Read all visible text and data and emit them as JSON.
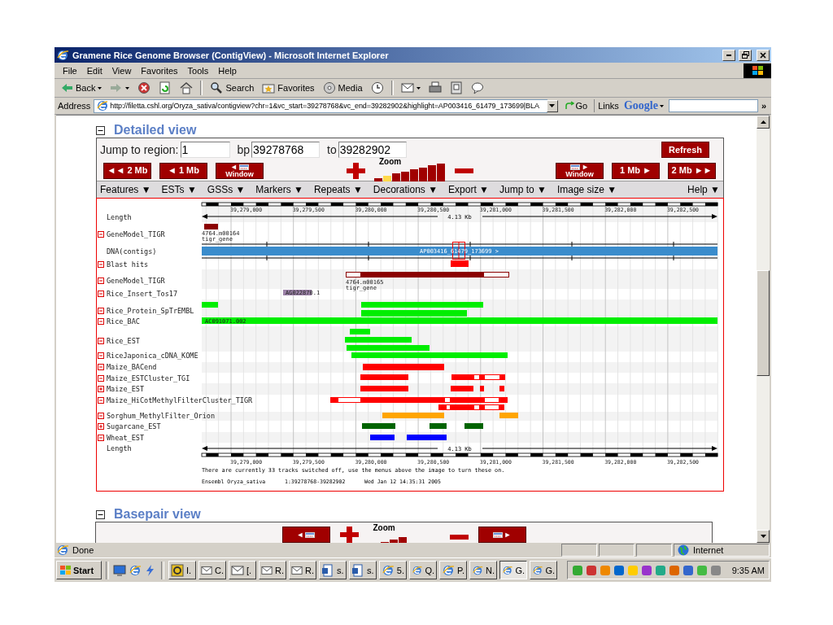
{
  "window": {
    "title": "Gramene Rice Genome Browser (ContigView) - Microsoft Internet Explorer"
  },
  "menu": [
    "File",
    "Edit",
    "View",
    "Favorites",
    "Tools",
    "Help"
  ],
  "toolbar": [
    {
      "kind": "back",
      "label": "Back"
    },
    {
      "kind": "forward"
    },
    {
      "kind": "stop"
    },
    {
      "kind": "refresh"
    },
    {
      "kind": "home"
    },
    {
      "kind": "search",
      "label": "Search"
    },
    {
      "kind": "favorites",
      "label": "Favorites"
    },
    {
      "kind": "media",
      "label": "Media"
    },
    {
      "kind": "history"
    },
    {
      "kind": "mail"
    },
    {
      "kind": "print"
    },
    {
      "kind": "edit"
    },
    {
      "kind": "discuss"
    }
  ],
  "address_bar": {
    "label": "Address",
    "url": "http://filetta.cshl.org/Oryza_sativa/contigview?chr=1&vc_start=39278768&vc_end=39282902&highlight=AP003416_61479_173699|BLA",
    "go": "Go",
    "links": "Links",
    "google": "Google",
    "more": "»"
  },
  "detailed_view": {
    "title": "Detailed view",
    "expanded": true,
    "jump_label": "Jump to region:",
    "region": "1",
    "bp_label": "bp",
    "start": "39278768",
    "to_label": "to",
    "end": "39282902",
    "refresh": "Refresh",
    "nav_left": [
      {
        "kind": "step",
        "label": "◄◄ 2 Mb"
      },
      {
        "kind": "step",
        "label": "◄ 1 Mb"
      },
      {
        "kind": "window",
        "arrow": "◄",
        "label": "Window"
      }
    ],
    "zoom": {
      "label": "Zoom",
      "steps": [
        {
          "selected": false
        },
        {
          "selected": true
        },
        {
          "selected": false
        },
        {
          "selected": false
        },
        {
          "selected": false
        },
        {
          "selected": false
        },
        {
          "selected": false
        },
        {
          "selected": false
        }
      ]
    },
    "nav_right": [
      {
        "kind": "window",
        "arrow": "►",
        "label": "Window"
      },
      {
        "kind": "step",
        "label": "1 Mb ►"
      },
      {
        "kind": "step",
        "label": "2 Mb ►►"
      }
    ],
    "menus": [
      "Features ▼",
      "ESTs ▼",
      "GSSs ▼",
      "Markers ▼",
      "Repeats ▼",
      "Decorations ▼",
      "Export ▼",
      "Jump to ▼",
      "Image size ▼"
    ],
    "help": "Help ▼"
  },
  "tracks_panel": {
    "top_ticks": [
      "39,279,000",
      "39,279,500",
      "39,280,000",
      "39,280,500",
      "39,281,000",
      "39,281,500",
      "39,282,000",
      "39,282,500"
    ],
    "tracks": [
      {
        "kind": "scale",
        "label": "Length",
        "span": "4.13 Kb"
      },
      {
        "kind": "track",
        "label": "GeneModel_TIGR",
        "expanded": true,
        "color": "#8b0000",
        "feature_labels": [
          "4764.m00164",
          "tigr_gene"
        ]
      },
      {
        "kind": "contig",
        "label": "DNA(contigs)",
        "color": "#3a8ccc",
        "feature_labels": [
          "AP003416_61479_173699 >"
        ]
      },
      {
        "kind": "track",
        "label": "Blast hits",
        "expanded": true,
        "color": "#ff0000"
      },
      {
        "kind": "track",
        "label": "GeneModel_TIGR",
        "expanded": true,
        "color": "#8b0000",
        "feature_labels": [
          "4764.m00165",
          "tigr_gene"
        ]
      },
      {
        "kind": "track",
        "label": "Rice_Insert_Tos17",
        "expanded": true,
        "color": "#9c82a8",
        "feature_labels": [
          "AG022870.1"
        ]
      },
      {
        "kind": "track",
        "label": "Rice_Protein_SpTrEMBL",
        "expanded": true,
        "color": "#00ee00"
      },
      {
        "kind": "track",
        "label": "Rice_BAC",
        "expanded": true,
        "color": "#00ee00",
        "feature_labels": [
          "AC091071.002"
        ]
      },
      {
        "kind": "track",
        "label": "Rice_EST",
        "expanded": true,
        "color": "#00ee00"
      },
      {
        "kind": "track",
        "label": "RiceJaponica_cDNA_KOME",
        "expanded": true,
        "color": "#00ee00"
      },
      {
        "kind": "track",
        "label": "Maize_BACend",
        "expanded": true,
        "color": "#ff0000"
      },
      {
        "kind": "track",
        "label": "Maize_ESTCluster_TGI",
        "expanded": true,
        "color": "#ff0000"
      },
      {
        "kind": "track",
        "label": "Maize_EST",
        "expanded": false,
        "color": "#ff0000"
      },
      {
        "kind": "track",
        "label": "Maize_HiCotMethylFilterCluster_TIGR",
        "expanded": true,
        "color": "#ff0000"
      },
      {
        "kind": "track",
        "label": "Sorghum_MethylFilter_Orion",
        "expanded": true,
        "color": "#ffa500"
      },
      {
        "kind": "track",
        "label": "Sugarcane_EST",
        "expanded": false,
        "color": "#006400"
      },
      {
        "kind": "track",
        "label": "Wheat_EST",
        "expanded": true,
        "color": "#0000ff"
      },
      {
        "kind": "scale",
        "label": "Length",
        "span": "4.13 Kb"
      }
    ],
    "bottom_ticks": [
      "39,279,000",
      "39,279,500",
      "39,280,000",
      "39,280,500",
      "39,281,000",
      "39,281,500",
      "39,282,000",
      "39,282,500"
    ],
    "notice": "There are currently 33 tracks switched off, use the menus above the image to turn these on.",
    "footer": [
      "Ensembl Oryza_sativa",
      "1:39278768-39282902",
      "Wed Jan 12 14:35:31 2005"
    ]
  },
  "basepair_view": {
    "title": "Basepair view",
    "expanded": true,
    "nav_left": [
      {
        "kind": "window",
        "arrow": "◄"
      }
    ],
    "zoom": {
      "label": "Zoom"
    },
    "nav_right": [
      {
        "kind": "window",
        "arrow": "►"
      }
    ]
  },
  "status_bar": {
    "text": "Done",
    "zone": "Internet"
  },
  "taskbar": {
    "start": "Start",
    "tasks": [
      {
        "kind": "app",
        "label": "I.",
        "selected": false
      },
      {
        "kind": "mail",
        "label": "C.",
        "selected": false
      },
      {
        "kind": "mail",
        "label": "[.",
        "selected": false
      },
      {
        "kind": "mail",
        "label": "R.",
        "selected": false
      },
      {
        "kind": "mail",
        "label": "R.",
        "selected": false
      },
      {
        "kind": "doc",
        "label": "s.",
        "selected": false
      },
      {
        "kind": "doc",
        "label": "s.",
        "selected": false
      },
      {
        "kind": "browser",
        "label": "5.",
        "selected": false
      },
      {
        "kind": "browser",
        "label": "Q.",
        "selected": false
      },
      {
        "kind": "browser",
        "label": "P.",
        "selected": false
      },
      {
        "kind": "browser",
        "label": "N.",
        "selected": false
      },
      {
        "kind": "browser",
        "label": "G.",
        "selected": true
      },
      {
        "kind": "browser",
        "label": "G.",
        "selected": false
      }
    ],
    "clock": "9:35 AM"
  }
}
